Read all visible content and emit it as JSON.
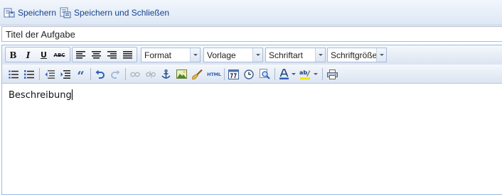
{
  "toolbar": {
    "save_label": "Speichern",
    "save_close_label": "Speichern und Schließen"
  },
  "title_field": {
    "value": "Titel der Aufgabe"
  },
  "editor": {
    "combos": {
      "format": "Format",
      "template": "Vorlage",
      "font": "Schriftart",
      "font_size": "Schriftgröße"
    },
    "content": "Beschreibung"
  }
}
